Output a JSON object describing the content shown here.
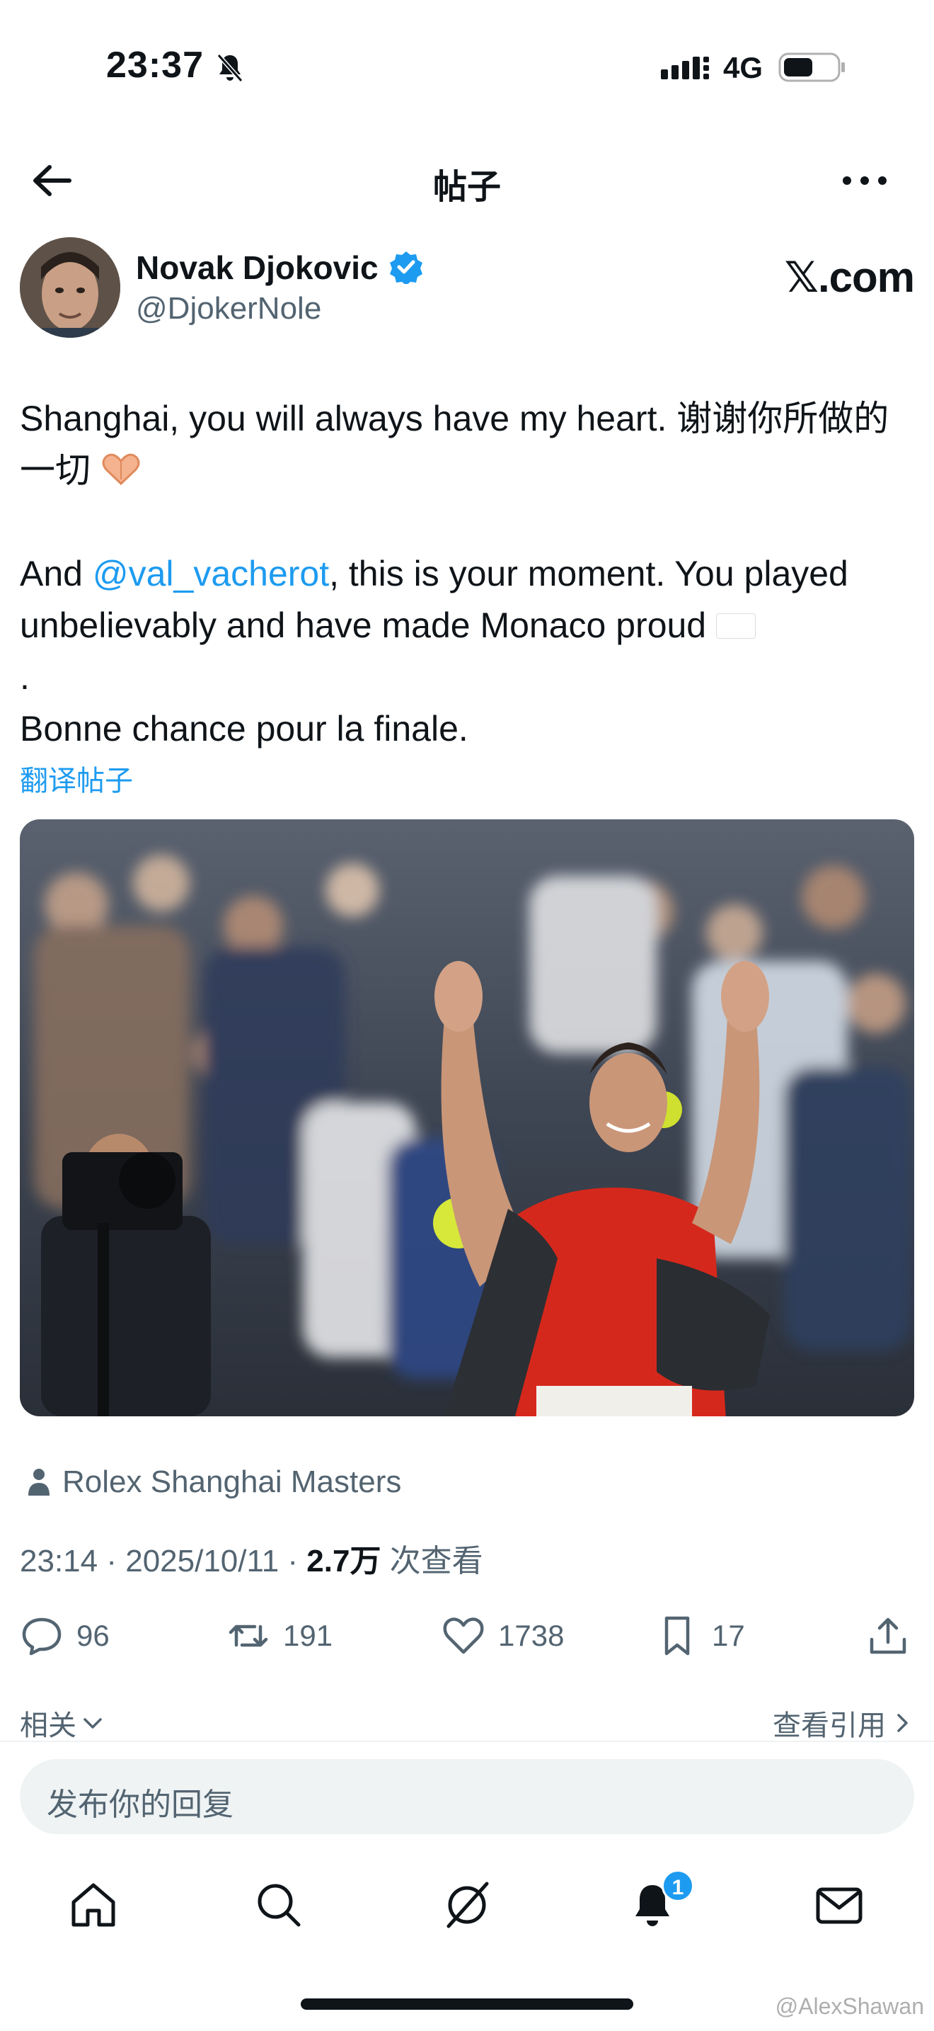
{
  "status_bar": {
    "time": "23:37",
    "network": "4G",
    "icons": [
      "bell-off-icon",
      "signal-icon",
      "battery-icon"
    ]
  },
  "header": {
    "title": "帖子",
    "icons": [
      "back-arrow-icon",
      "more-icon"
    ]
  },
  "author": {
    "name": "Novak Djokovic",
    "handle": "@DjokerNole",
    "verified": true,
    "source_brand": "𝕏.com"
  },
  "tweet": {
    "line1_text": "Shanghai, you will always have my heart. 谢谢你所做的一切",
    "line1_emoji": "heart-hands-icon",
    "para2_prefix": "And ",
    "mention": "@val_vacherot",
    "para2_text": ", this is your moment. You played unbelievably and have made Monaco proud",
    "para2_flag": "monaco-flag-icon",
    "para2_after_flag": ".",
    "para3": "Bonne chance pour la finale.",
    "translate_label": "翻译帖子"
  },
  "location": "Rolex Shanghai Masters",
  "meta": {
    "time": "23:14",
    "sep1": " · ",
    "date": "2025/10/11",
    "sep2": " · ",
    "views": "2.7万",
    "views_label": " 次查看"
  },
  "actions": {
    "replies": "96",
    "reposts": "191",
    "likes": "1738",
    "bookmarks": "17"
  },
  "related": {
    "label": "相关",
    "view_quotes": "查看引用"
  },
  "reply_box": {
    "placeholder": "发布你的回复"
  },
  "tabbar": {
    "tabs": [
      "home-icon",
      "search-icon",
      "grok-icon",
      "notifications-icon",
      "messages-icon"
    ],
    "notification_badge": "1"
  },
  "watermark": "@AlexShawan",
  "colors": {
    "accent": "#1d9bf0",
    "text": "#0f1419",
    "secondary": "#536471"
  }
}
